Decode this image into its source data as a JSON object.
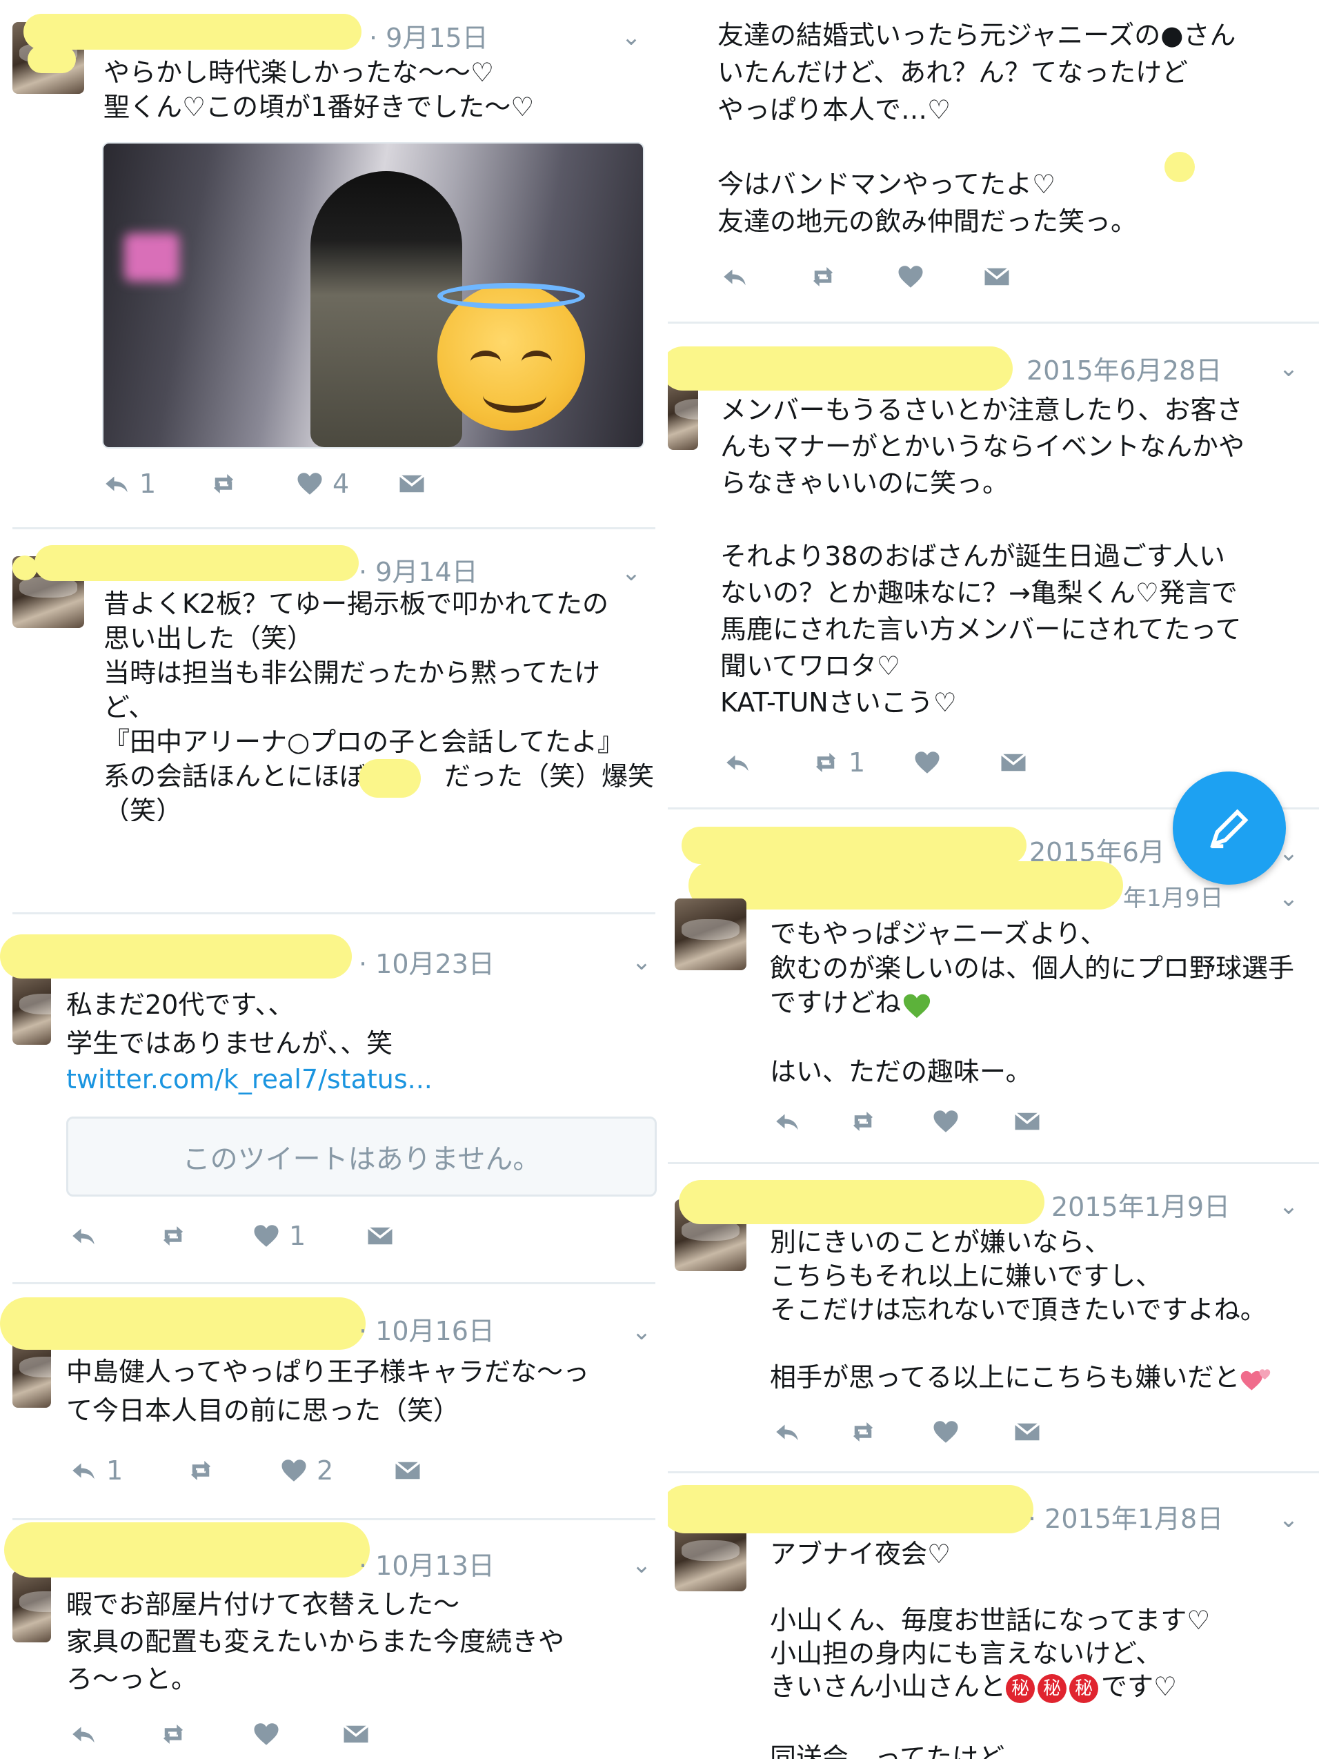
{
  "colors": {
    "accent": "#1da1f2",
    "muted": "#8899a6",
    "text": "#14171a",
    "redaction": "#fbf68a",
    "divider": "#e6ecf0",
    "link": "#1b95e0"
  },
  "left_column": {
    "tweets": [
      {
        "date": "· 9月15日",
        "text": "やらかし時代楽しかったな〜〜♡\n聖くん♡この頃が1番好きでした〜♡",
        "replies": "1",
        "retweets": "",
        "likes": "4"
      },
      {
        "date": "· 9月14日",
        "text": "昔よくK2板？てゆー掲示板で叩かれてたの\n思い出した（笑）\n当時は担当も非公開だったから黙ってたけ\nど、\n『田中アリーナ○プロの子と会話してたよ』\n系の会話ほんとにほぼ　　　だった（笑）爆笑\n（笑）",
        "replies": "",
        "retweets": "",
        "likes": ""
      },
      {
        "date": "· 10月23日",
        "text": "私まだ20代です、、\n学生ではありませんが、、笑",
        "link": "twitter.com/k_real7/status...",
        "quoted": "このツイートはありません。",
        "replies": "",
        "retweets": "",
        "likes": "1"
      },
      {
        "date": "· 10月16日",
        "text": "中島健人ってやっぱり王子様キャラだな〜っ\nて今日本人目の前に思った（笑）",
        "replies": "1",
        "retweets": "",
        "likes": "2"
      },
      {
        "date": "· 10月13日",
        "text": "暇でお部屋片付けて衣替えした〜\n家具の配置も変えたいからまた今度続きや\nろ〜っと。",
        "replies": "",
        "retweets": "",
        "likes": ""
      }
    ]
  },
  "right_column": {
    "tweets": [
      {
        "date": "",
        "text": "友達の結婚式いったら元ジャニーズの●さん\nいたんだけど、あれ？ん？てなったけど\nやっぱり本人で…♡\n\n今はバンドマンやってたよ♡\n友達の地元の飲み仲間だった笑っ。",
        "replies": "",
        "retweets": "",
        "likes": ""
      },
      {
        "date": "2015年6月28日",
        "text": "メンバーもうるさいとか注意したり、お客さ\nんもマナーがとかいうならイベントなんかや\nらなきゃいいのに笑っ。\n\nそれより38のおばさんが誕生日過ごす人い\nないの？とか趣味なに？→亀梨くん♡発言で\n馬鹿にされた言い方メンバーにされてたって\n聞いてワロタ♡\nKAT-TUNさいこう♡",
        "replies": "",
        "retweets": "1",
        "likes": ""
      },
      {
        "date": "2015年6月",
        "date_under": "年1月9日",
        "text": "でもやっぱジャニーズより、\n飲むのが楽しいのは、個人的にプロ野球選手\nですけどね",
        "text_tail": "\n\nはい、ただの趣味ー。",
        "replies": "",
        "retweets": "",
        "likes": ""
      },
      {
        "date": "2015年1月9日",
        "text": "別にきいのことが嫌いなら、\nこちらもそれ以上に嫌いですし、\nそこだけは忘れないで頂きたいですよね。\n\n相手が思ってる以上にこちらも嫌いだと",
        "replies": "",
        "retweets": "",
        "likes": ""
      },
      {
        "date": "· 2015年1月8日",
        "text_1": "アブナイ夜会♡\n\n小山くん、毎度お世話になってます♡\n小山担の身内にも言えないけど、\nきいさん小山さんと",
        "stamp": "秘",
        "text_2": "です♡",
        "text_3": "同送会　ってたけど",
        "replies": "",
        "retweets": "",
        "likes": ""
      }
    ]
  },
  "icons": {
    "reply": "reply-icon",
    "retweet": "retweet-icon",
    "like": "heart-icon",
    "dm": "dm-envelope-icon",
    "more": "chevron-down-icon",
    "compose": "compose-icon"
  }
}
